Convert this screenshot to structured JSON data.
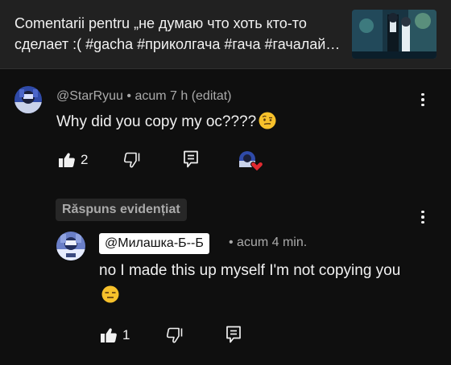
{
  "header": {
    "title": "Comentarii pentru „не думаю что хоть кто-то сделает :( #gacha #приколгача #гача #гачалайф #гачаклуб"
  },
  "comment": {
    "author": "@StarRyuu",
    "meta": "• acum 7 h (editat)",
    "text": "Why did you copy my oc????",
    "emoji_icon": "raised-eyebrow-face-emoji",
    "like_count": "2"
  },
  "reply": {
    "highlight_label": "Răspuns evidențiat",
    "author": "@Милашка-Б--Б",
    "meta": "• acum 4 min.",
    "text": "no I made this up myself I'm not copying you",
    "emoji_icon": "expressionless-face-emoji",
    "like_count": "1"
  },
  "colors": {
    "background": "#0f0f0f",
    "header_background": "#212121",
    "secondary_text": "#aaaaaa",
    "heart": "#e02a30",
    "emoji": "#f7c12b"
  }
}
